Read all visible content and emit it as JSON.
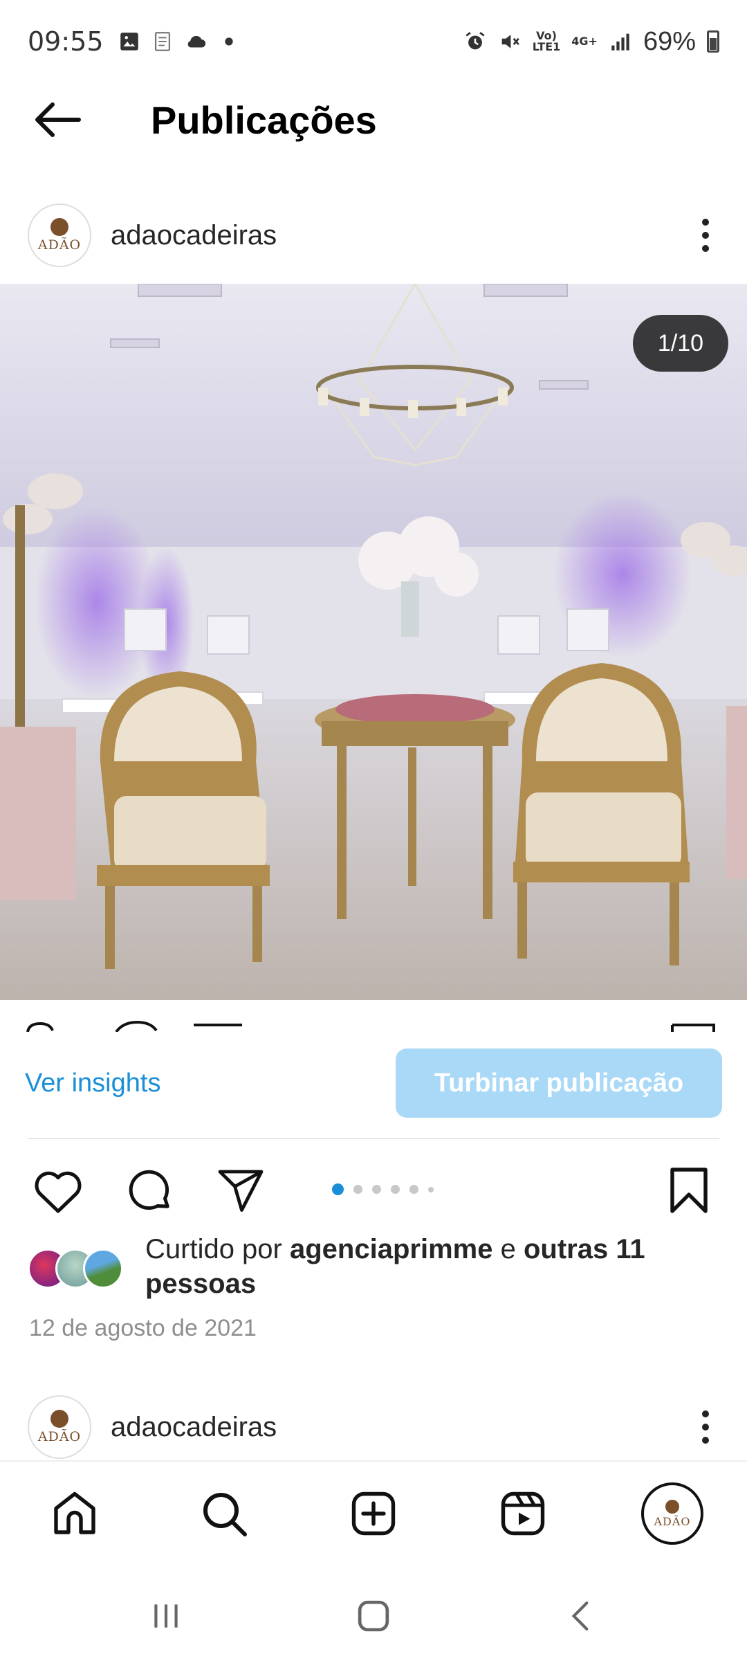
{
  "status_bar": {
    "time": "09:55",
    "network_badge_1": "Vo)\nLTE1",
    "network_badge_2": "4G+",
    "battery": "69%"
  },
  "header": {
    "title": "Publicações"
  },
  "post": {
    "username": "adaocadeiras",
    "avatar_text": "ADÃO",
    "counter": "1/10",
    "carousel": {
      "total_dots": 6,
      "active_index": 0
    },
    "insights_label": "Ver insights",
    "boost_label": "Turbinar publicação",
    "likes": {
      "prefix": "Curtido por",
      "user": "agenciaprimme",
      "connector": "e",
      "others": "outras 11 pessoas"
    },
    "date": "12 de agosto de 2021"
  },
  "next_post": {
    "username": "adaocadeiras",
    "avatar_text": "ADÃO"
  },
  "colors": {
    "link_blue": "#1a8fd8",
    "boost_bg": "#a9d9f7"
  },
  "icons": {
    "back": "arrow-left-icon",
    "more": "more-vertical-icon",
    "like": "heart-icon",
    "comment": "comment-icon",
    "share": "send-icon",
    "save": "bookmark-icon",
    "home": "home-icon",
    "search": "search-icon",
    "create": "add-post-icon",
    "reels": "reels-icon"
  }
}
